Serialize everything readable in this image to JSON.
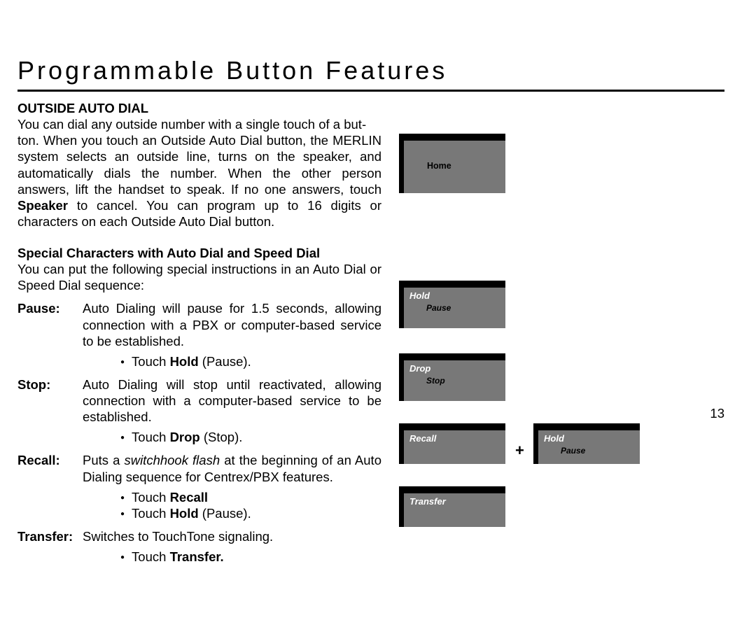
{
  "title": "Programmable Button Features",
  "section1": "OUTSIDE AUTO DIAL",
  "para1a": "You can dial any outside number with a single touch of a but-",
  "para1b": "ton. When you touch an Outside Auto Dial button, the MERLIN",
  "para1c": "system selects an outside line, turns on the speaker, and automatically dials the number. When the other person answers, lift the handset to speak. If no one answers, touch ",
  "para1_bold": "Speaker",
  "para1d": " to cancel. You can program up to 16 digits or characters on each Outside Auto Dial button.",
  "subhead": "Special Characters with Auto Dial and Speed Dial",
  "para2": "You can put the following special instructions in an Auto Dial or Speed Dial sequence:",
  "defs": {
    "pause": {
      "term": "Pause:",
      "body": "Auto Dialing will pause for 1.5 seconds, allowing connection with a PBX or computer-based service to be established.",
      "b1a": "Touch ",
      "b1b": "Hold",
      "b1c": " (Pause)."
    },
    "stop": {
      "term": "Stop:",
      "body": "Auto Dialing will stop until reactivated, allowing connection with a computer-based service to be established.",
      "b1a": "Touch ",
      "b1b": "Drop",
      "b1c": " (Stop)."
    },
    "recall": {
      "term": "Recall:",
      "body1": "Puts a ",
      "body_i": "switchhook flash",
      "body2": " at the beginning of an Auto Dialing sequence for Centrex/PBX features.",
      "b1a": "Touch ",
      "b1b": "Recall",
      "b2a": "Touch ",
      "b2b": "Hold",
      "b2c": " (Pause)."
    },
    "transfer": {
      "term": "Transfer:",
      "body": "Switches to TouchTone signaling.",
      "b1a": "Touch ",
      "b1b": "Transfer."
    }
  },
  "buttons": {
    "home": "Home",
    "hold": "Hold",
    "pause": "Pause",
    "drop": "Drop",
    "stop": "Stop",
    "recall": "Recall",
    "transfer": "Transfer"
  },
  "plus": "+",
  "pagenum": "13"
}
